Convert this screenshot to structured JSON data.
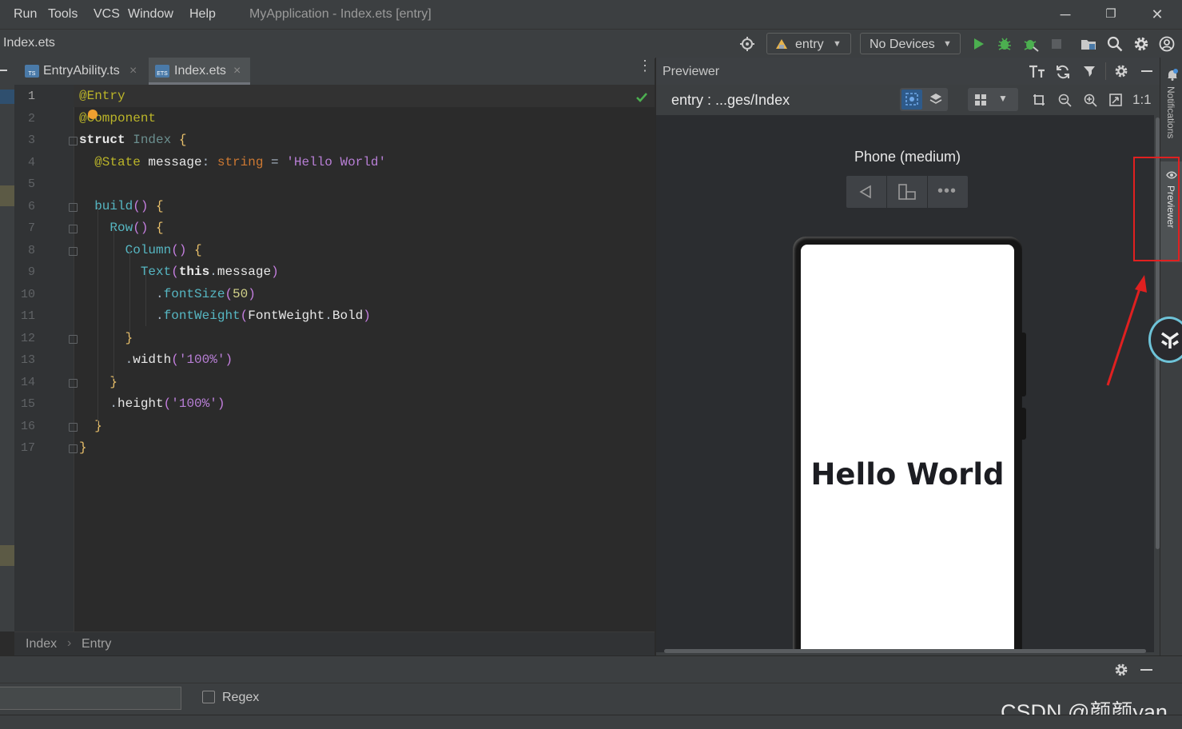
{
  "menu": {
    "run": "Run",
    "tools": "Tools",
    "vcs": "VCS",
    "window": "Window",
    "help": "Help"
  },
  "window_title": "MyApplication - Index.ets [entry]",
  "window_controls": {
    "minimize": "─",
    "restore": "❐",
    "close": "✕"
  },
  "nav": {
    "file": "Index.ets",
    "module_combo": "entry",
    "device_combo": "No Devices"
  },
  "tabs": [
    {
      "label": "EntryAbility.ts",
      "active": false
    },
    {
      "label": "Index.ets",
      "active": true
    }
  ],
  "tab_close": "×",
  "code": {
    "line_numbers": [
      "1",
      "2",
      "3",
      "4",
      "5",
      "6",
      "7",
      "8",
      "9",
      "10",
      "11",
      "12",
      "13",
      "14",
      "15",
      "16",
      "17"
    ],
    "lines": [
      "@Entry",
      "@Component",
      "struct Index {",
      "  @State message: string = 'Hello World'",
      "",
      "  build() {",
      "    Row() {",
      "      Column() {",
      "        Text(this.message)",
      "          .fontSize(50)",
      "          .fontWeight(FontWeight.Bold)",
      "      }",
      "      .width('100%')",
      "    }",
      "    .height('100%')",
      "  }",
      "}"
    ]
  },
  "breadcrumb": {
    "item1": "Index",
    "sep": "›",
    "item2": "Entry"
  },
  "previewer": {
    "title": "Previewer",
    "page_path": "entry : ...ges/Index",
    "device_name": "Phone (medium)",
    "zoom_one_to_one": "1:1",
    "preview_text": "Hello World"
  },
  "right_strip": {
    "notifications": "Notifications",
    "previewer_tab": "Previewer"
  },
  "search": {
    "regex_label": "Regex",
    "regex_checked": false
  },
  "watermark": "CSDN @颜颜yan_",
  "colors": {
    "highlight_box": "#e02020",
    "arrow": "#e02020",
    "run_green": "#4caf50"
  },
  "icons": [
    "target-icon",
    "run-icon",
    "debug-icon",
    "attach-debug-icon",
    "stop-icon",
    "project-structure-icon",
    "search-icon",
    "settings-icon",
    "account-icon",
    "font-size-icon",
    "refresh-icon",
    "pin-icon",
    "gear-icon",
    "minimize-icon",
    "inspect-icon",
    "layers-icon",
    "grid-icon",
    "crop-icon",
    "zoom-out-icon",
    "zoom-in-icon",
    "fit-icon",
    "back-icon",
    "rotate-icon",
    "more-icon",
    "bell-icon",
    "eye-icon",
    "checkmark-icon"
  ]
}
